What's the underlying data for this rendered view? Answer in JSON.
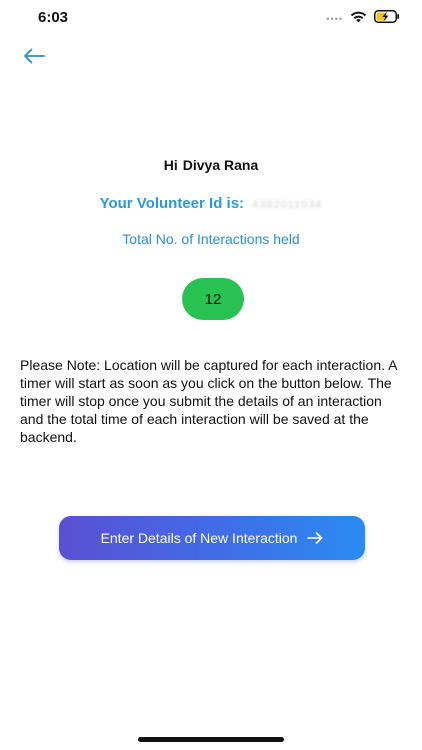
{
  "status_bar": {
    "time": "6:03",
    "signal_dots": "••••",
    "icons": [
      "wifi-icon",
      "battery-charging-icon"
    ]
  },
  "navigation": {
    "back_icon": "arrow-left-icon",
    "accent_color": "#2a8fd0"
  },
  "greeting": {
    "prefix": "Hi",
    "name": "Divya Rana"
  },
  "volunteer": {
    "label": "Your Volunteer Id is:",
    "id_value": "4392011034"
  },
  "interactions": {
    "label": "Total No. of Interactions held",
    "count": "12",
    "badge_color": "#28c253"
  },
  "note": {
    "text": "Please Note: Location will be captured for each interaction. A timer will start as soon as you click on the button below. The timer will stop once you submit the details of an interaction and the total time of each interaction will be saved at the backend."
  },
  "action": {
    "button_label": "Enter Details of New Interaction",
    "button_icon": "arrow-right-icon"
  }
}
